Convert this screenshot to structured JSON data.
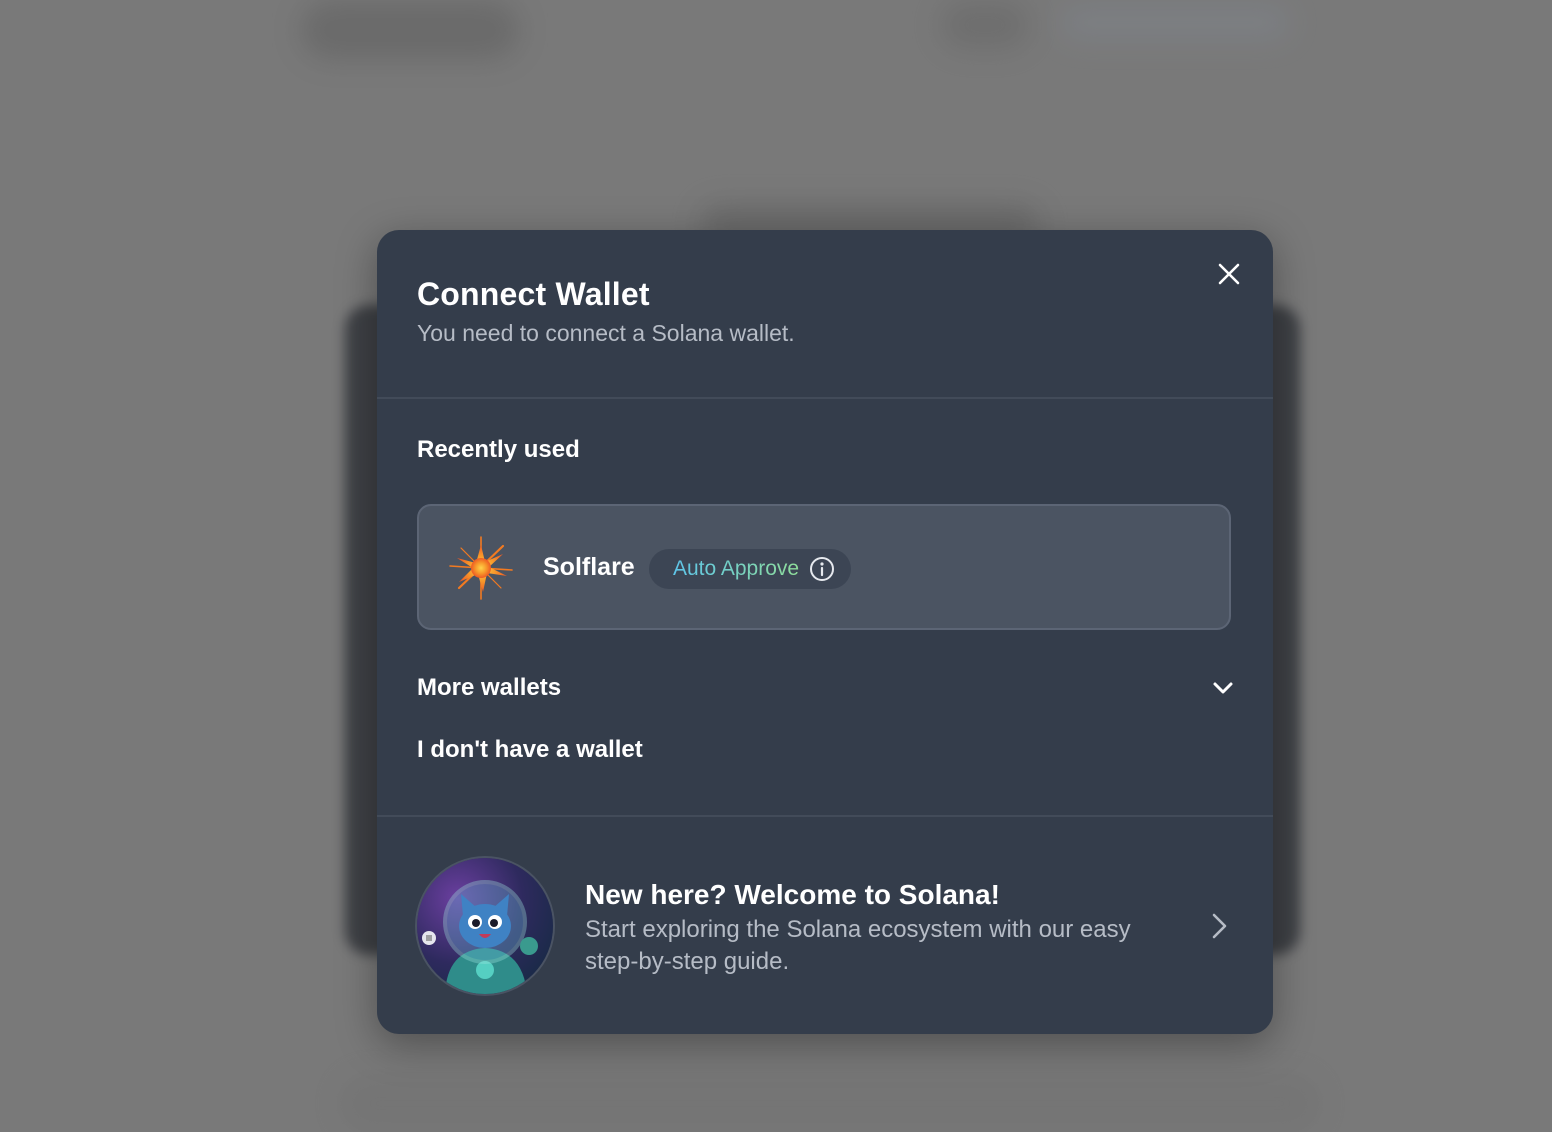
{
  "modal": {
    "title": "Connect Wallet",
    "subtitle": "You need to connect a Solana wallet.",
    "close_icon": "close-icon"
  },
  "recent": {
    "label": "Recently used",
    "wallet": {
      "name": "Solflare",
      "logo_icon": "solflare-star-icon",
      "badge_label": "Auto Approve",
      "badge_icon": "info-icon"
    }
  },
  "more_wallets": {
    "label": "More wallets",
    "icon": "chevron-down-icon"
  },
  "no_wallet": {
    "label": "I don't have a wallet"
  },
  "promo": {
    "title": "New here? Welcome to Solana!",
    "description": "Start exploring the Solana ecosystem with our easy step-by-step guide.",
    "image": "astronaut-cat-avatar",
    "icon": "chevron-right-icon"
  },
  "colors": {
    "modal_bg": "#343d4b",
    "card_bg": "#4b5462",
    "muted_text": "#b6bcc6",
    "badge_gradient_start": "#5ec5ea",
    "badge_gradient_end": "#8fdd9a",
    "solflare_orange": "#f27a21"
  }
}
